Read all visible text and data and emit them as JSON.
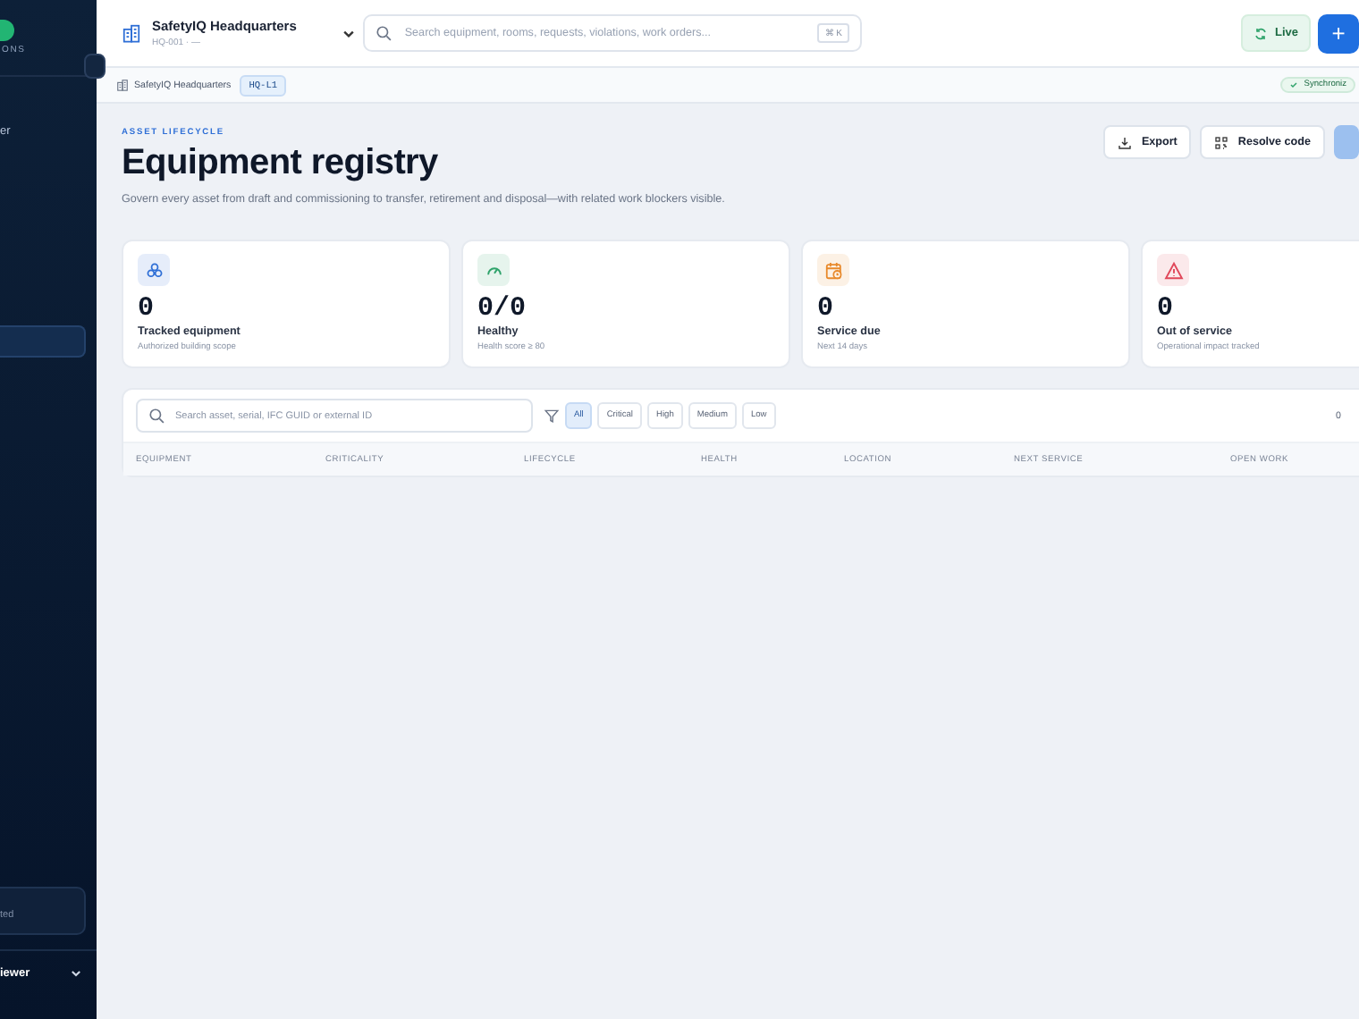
{
  "sidebar": {
    "brand_fragment": "ONS",
    "nav_fragment": "er",
    "items": [
      {
        "selected": false
      },
      {
        "selected": true
      }
    ],
    "footer_card_fragment": "ted",
    "user_fragment": "iewer"
  },
  "header": {
    "site": {
      "title": "SafetyIQ Headquarters",
      "subtitle": "HQ-001 · —"
    },
    "search": {
      "placeholder": "Search equipment, rooms, requests, violations, work orders...",
      "shortcut": "⌘ K"
    },
    "live_button": "Live",
    "add_button": "+"
  },
  "breadcrumb": {
    "site": "SafetyIQ Headquarters",
    "chips": [
      {
        "label": "HQ-L1",
        "selected": true
      }
    ],
    "sync_status": "Synchroniz"
  },
  "page": {
    "eyebrow": "ASSET LIFECYCLE",
    "title": "Equipment registry",
    "description": "Govern every asset from draft and commissioning to transfer, retirement and disposal—with related work blockers visible.",
    "actions": [
      {
        "kind": "export",
        "label": "Export"
      },
      {
        "kind": "resolve",
        "label": "Resolve code"
      },
      {
        "kind": "primary"
      }
    ]
  },
  "stats": [
    {
      "kind": "tracked",
      "value": "0",
      "label": "Tracked equipment",
      "note": "Authorized building scope",
      "color": "#2f6fd6"
    },
    {
      "kind": "healthy",
      "value": "0/0",
      "label": "Healthy",
      "note": "Health score ≥ 80",
      "color": "#2fa36b"
    },
    {
      "kind": "service",
      "value": "0",
      "label": "Service due",
      "note": "Next 14 days",
      "color": "#e8892b"
    },
    {
      "kind": "outage",
      "value": "0",
      "label": "Out of service",
      "note": "Operational impact tracked",
      "color": "#e0475a"
    }
  ],
  "table": {
    "search": {
      "placeholder": "Search asset, serial, IFC GUID or external ID"
    },
    "filters": [
      {
        "label": "All",
        "selected": true
      },
      {
        "label": "Critical",
        "selected": false
      },
      {
        "label": "High",
        "selected": false
      },
      {
        "label": "Medium",
        "selected": false
      },
      {
        "label": "Low",
        "selected": false
      }
    ],
    "count": "0",
    "columns": [
      "EQUIPMENT",
      "CRITICALITY",
      "LIFECYCLE",
      "HEALTH",
      "LOCATION",
      "NEXT SERVICE",
      "OPEN WORK"
    ]
  }
}
